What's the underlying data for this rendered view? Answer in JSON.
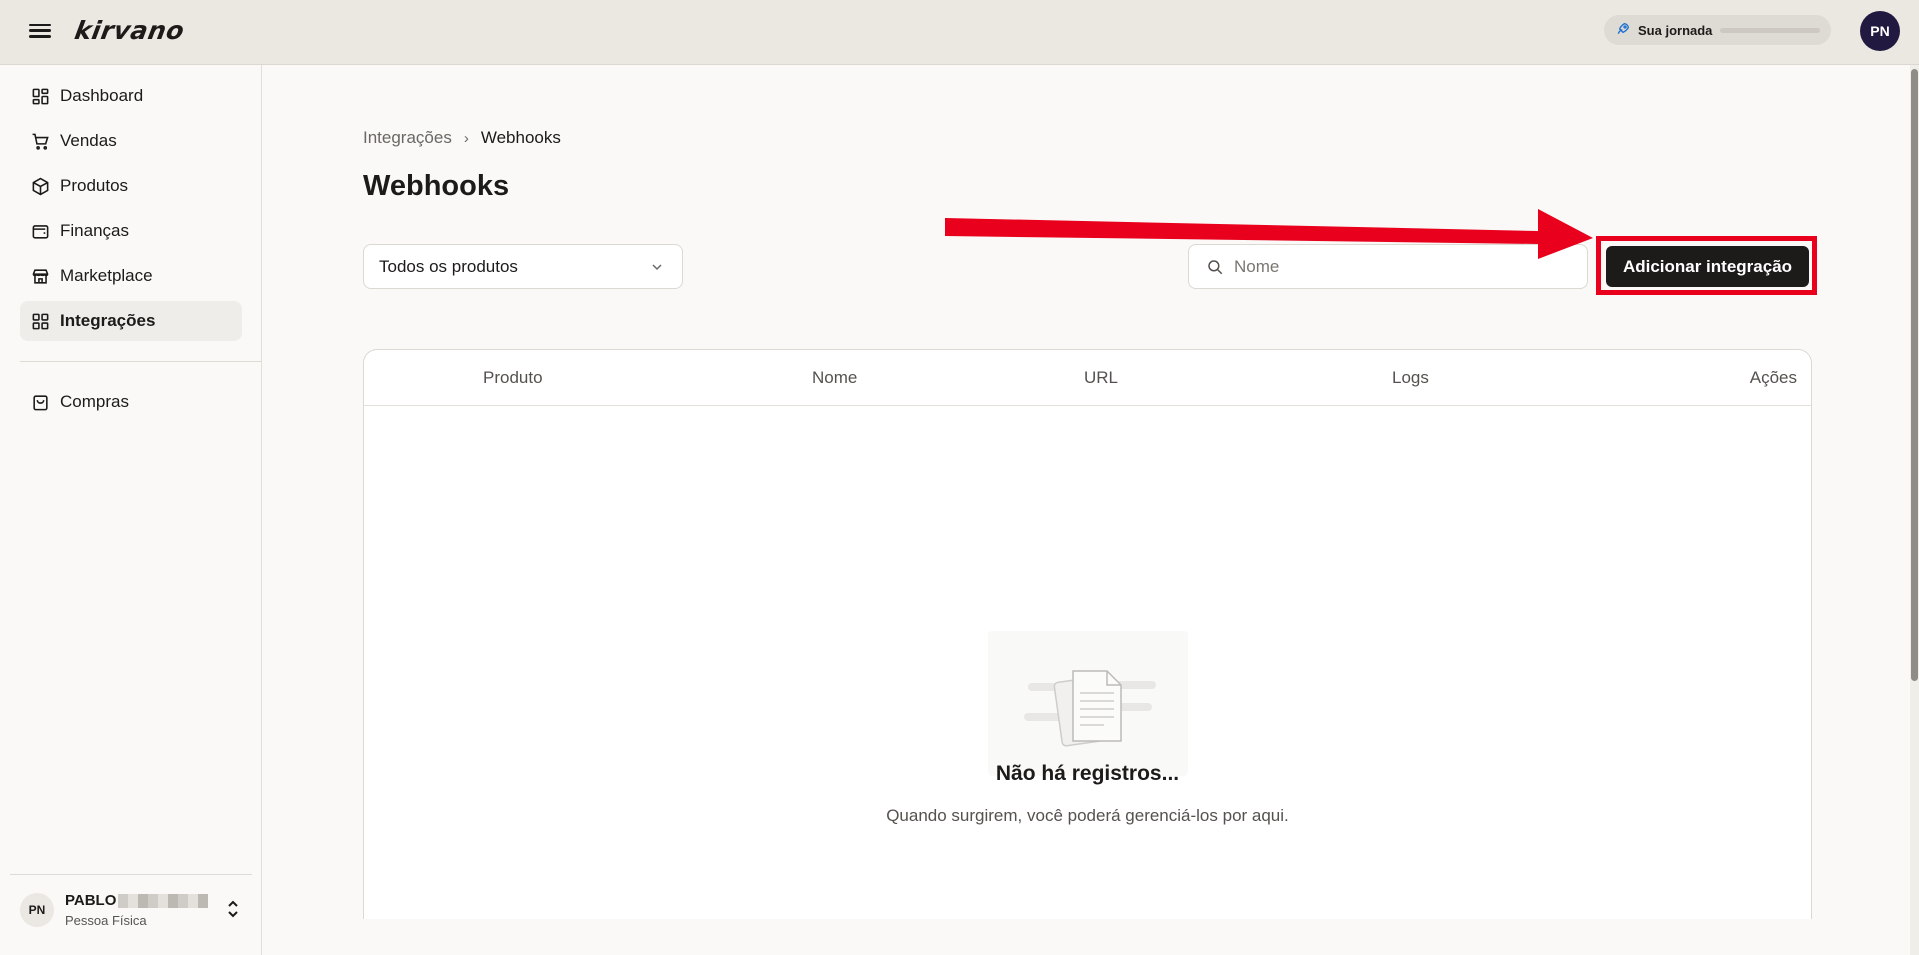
{
  "topbar": {
    "logo": "kirvano",
    "journey_label": "Sua jornada",
    "journey_progress_pct": 0,
    "avatar_initials": "PN"
  },
  "sidebar": {
    "items": [
      {
        "label": "Dashboard",
        "icon": "dashboard-icon"
      },
      {
        "label": "Vendas",
        "icon": "cart-icon"
      },
      {
        "label": "Produtos",
        "icon": "box-icon"
      },
      {
        "label": "Finanças",
        "icon": "wallet-icon"
      },
      {
        "label": "Marketplace",
        "icon": "store-icon"
      },
      {
        "label": "Integrações",
        "icon": "integrations-icon",
        "active": true
      },
      {
        "label": "Compras",
        "icon": "shopping-bag-icon"
      }
    ],
    "user": {
      "initials": "PN",
      "name": "PABLO",
      "type": "Pessoa Física"
    }
  },
  "breadcrumb": {
    "parent": "Integrações",
    "current": "Webhooks"
  },
  "page_title": "Webhooks",
  "filter": {
    "selected": "Todos os produtos"
  },
  "search": {
    "placeholder": "Nome"
  },
  "add_button_label": "Adicionar integração",
  "table": {
    "columns": [
      "Produto",
      "Nome",
      "URL",
      "Logs",
      "Ações"
    ],
    "rows": []
  },
  "empty_state": {
    "title": "Não há registros...",
    "subtitle": "Quando surgirem, você poderá gerenciá-los por aqui."
  },
  "colors": {
    "accent": "#1c1b1a",
    "highlight": "#e8001c",
    "avatar": "#21193f"
  }
}
